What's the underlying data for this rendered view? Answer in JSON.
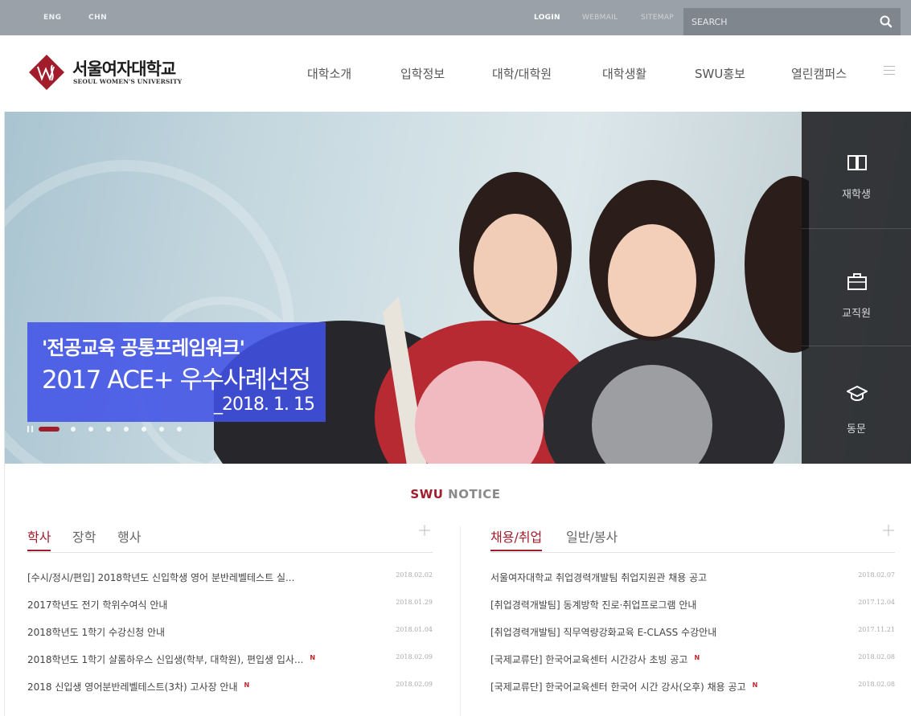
{
  "topbar": {
    "lang": [
      "ENG",
      "CHN"
    ],
    "login": "LOGIN",
    "webmail": "WEBMAIL",
    "sitemap": "SITEMAP",
    "search_placeholder": "SEARCH",
    "search_icon": "search-icon"
  },
  "logo": {
    "name_ko": "서울여자대학교",
    "name_en": "SEOUL WOMEN'S UNIVERSITY"
  },
  "nav": {
    "items": [
      "대학소개",
      "입학정보",
      "대학/대학원",
      "대학생활",
      "SWU홍보",
      "열린캠퍼스"
    ]
  },
  "hero": {
    "caption_line1": "'전공교육 공통프레임워크'",
    "caption_line2": "2017 ACE+ 우수사례선정",
    "caption_line3": "_2018. 1. 15",
    "slide_count": 8,
    "active_slide": 1
  },
  "quick": {
    "items": [
      {
        "label": "재학생",
        "icon": "book-icon"
      },
      {
        "label": "교직원",
        "icon": "briefcase-icon"
      },
      {
        "label": "동문",
        "icon": "graduation-cap-icon"
      }
    ]
  },
  "notice": {
    "title_strong": "SWU",
    "title_rest": " NOTICE",
    "left": {
      "tabs": [
        "학사",
        "장학",
        "행사"
      ],
      "active_tab": 0,
      "items": [
        {
          "title": "[수시/정시/편입] 2018학년도 신입학생 영어 분반레벨테스트 실...",
          "date": "2018.02.02",
          "new": false
        },
        {
          "title": "2017학년도 전기 학위수여식 안내",
          "date": "2018.01.29",
          "new": false
        },
        {
          "title": "2018학년도 1학기 수강신청 안내",
          "date": "2018.01.04",
          "new": false
        },
        {
          "title": "2018학년도 1학기 샬롬하우스 신입생(학부, 대학원), 편입생 입사...",
          "date": "2018.02.09",
          "new": true
        },
        {
          "title": "2018 신입생 영어분반레벨테스트(3차) 고사장 안내",
          "date": "2018.02.09",
          "new": true
        }
      ]
    },
    "right": {
      "tabs": [
        "채용/취업",
        "일반/봉사"
      ],
      "active_tab": 0,
      "items": [
        {
          "title": "서울여자대학교 취업경력개발팀 취업지원관 채용 공고",
          "date": "2018.02.07",
          "new": false
        },
        {
          "title": "[취업경력개발팀] 동계방학 진로·취업프로그램 안내",
          "date": "2017.12.04",
          "new": false
        },
        {
          "title": "[취업경력개발팀] 직무역량강화교육 E-CLASS 수강안내",
          "date": "2017.11.21",
          "new": false
        },
        {
          "title": "[국제교류단] 한국어교육센터 시간강사 초빙 공고",
          "date": "2018.02.08",
          "new": true
        },
        {
          "title": "[국제교류단] 한국어교육센터 한국어 시간 강사(오후) 채용 공고",
          "date": "2018.02.08",
          "new": true
        }
      ]
    },
    "new_badge": "N"
  },
  "colors": {
    "brand": "#a11d2b",
    "topbar": "#9aa1a8",
    "caption_bg": "#4152e6"
  }
}
